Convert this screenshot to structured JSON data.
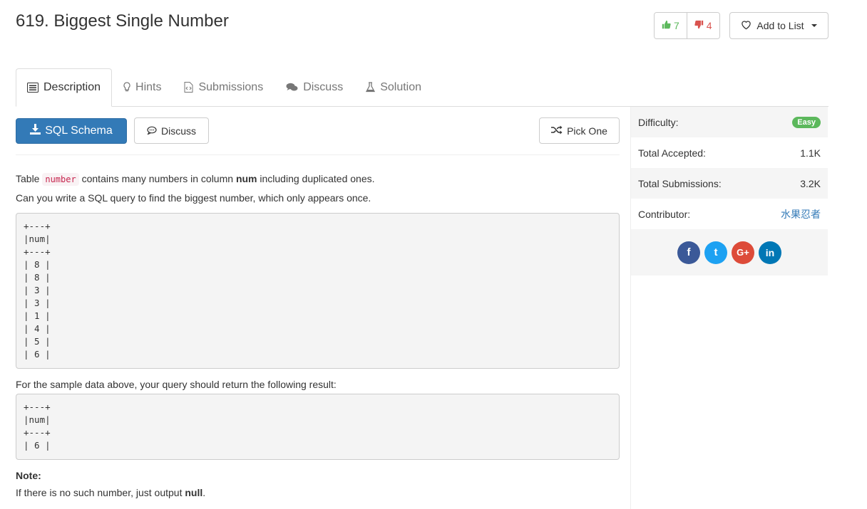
{
  "header": {
    "title": "619. Biggest Single Number",
    "upvotes": "7",
    "downvotes": "4",
    "add_to_list": "Add to List"
  },
  "tabs": [
    {
      "label": "Description",
      "icon": "description-icon"
    },
    {
      "label": "Hints",
      "icon": "lightbulb-icon"
    },
    {
      "label": "Submissions",
      "icon": "code-file-icon"
    },
    {
      "label": "Discuss",
      "icon": "comments-icon"
    },
    {
      "label": "Solution",
      "icon": "flask-icon"
    }
  ],
  "toolbar": {
    "sql_schema": "SQL Schema",
    "discuss": "Discuss",
    "pick_one": "Pick One"
  },
  "problem": {
    "intro_before": "Table ",
    "table_name": "number",
    "intro_middle": " contains many numbers in column ",
    "column": "num",
    "intro_after": " including duplicated ones.",
    "question": "Can you write a SQL query to find the biggest number, which only appears once.",
    "sample_table": "+---+\n|num|\n+---+\n| 8 |\n| 8 |\n| 3 |\n| 3 |\n| 1 |\n| 4 |\n| 5 |\n| 6 |",
    "result_intro": "For the sample data above, your query should return the following result:",
    "result_table": "+---+\n|num|\n+---+\n| 6 |",
    "note_label": "Note:",
    "note_before": "If there is no such number, just output ",
    "note_value": "null",
    "note_after": "."
  },
  "sidebar": {
    "difficulty_label": "Difficulty:",
    "difficulty_value": "Easy",
    "accepted_label": "Total Accepted:",
    "accepted_value": "1.1K",
    "submissions_label": "Total Submissions:",
    "submissions_value": "3.2K",
    "contributor_label": "Contributor:",
    "contributor_value": "水果忍者",
    "social": [
      {
        "name": "facebook",
        "glyph": "f",
        "color": "#3b5998"
      },
      {
        "name": "twitter",
        "glyph": "t",
        "color": "#1da1f2"
      },
      {
        "name": "google-plus",
        "glyph": "G+",
        "color": "#dd4b39"
      },
      {
        "name": "linkedin",
        "glyph": "in",
        "color": "#0077b5"
      }
    ]
  },
  "colors": {
    "primary": "#337ab7",
    "success": "#5cb85c",
    "danger": "#d9534f"
  }
}
